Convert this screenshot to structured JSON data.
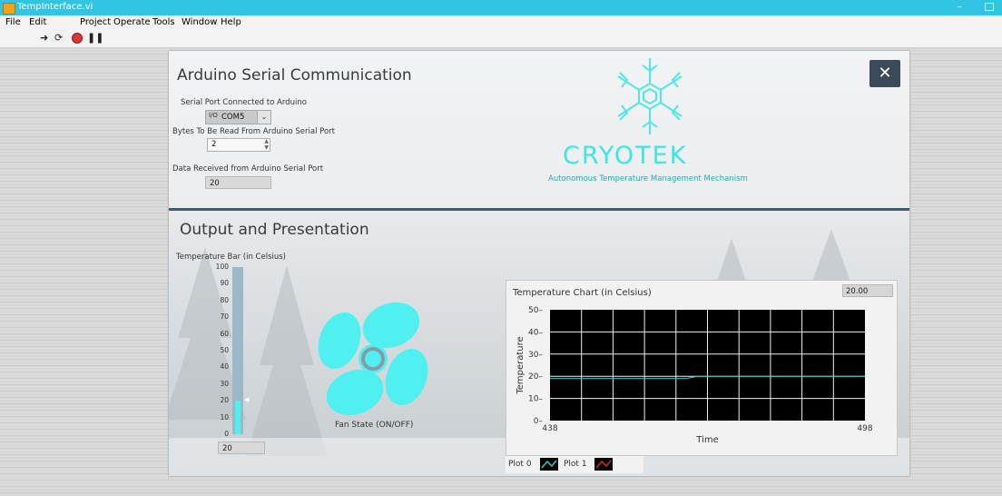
{
  "window": {
    "title": "TempInterface.vi"
  },
  "menu": [
    "File",
    "Edit",
    "Project",
    "Operate",
    "Tools",
    "Window",
    "Help"
  ],
  "serial": {
    "heading": "Arduino Serial Communication",
    "port_label": "Serial Port Connected to Arduino",
    "port_value": "COM5",
    "bytes_label": "Bytes To Be Read From Arduino Serial Port",
    "bytes_value": "2",
    "received_label": "Data Received from Arduino Serial Port",
    "received_value": "20"
  },
  "brand": {
    "name": "CRYOTEK",
    "tagline": "Autonomous Temperature Management Mechanism",
    "close_label": "✕"
  },
  "output": {
    "heading": "Output and Presentation",
    "bar_label": "Temperature Bar (in Celsius)",
    "bar_value": "20",
    "bar_level": 20,
    "bar_ticks": [
      "100",
      "90",
      "80",
      "70",
      "60",
      "50",
      "40",
      "30",
      "20",
      "10",
      "0"
    ],
    "fan_label": "Fan State (ON/OFF)"
  },
  "chart_data": {
    "type": "line",
    "title": "Temperature Chart (in Celsius)",
    "current_value": "20.00",
    "xlabel": "Time",
    "ylabel": "Temperature",
    "xlim": [
      438,
      498
    ],
    "ylim": [
      0,
      50
    ],
    "x_ticks": [
      "438",
      "498"
    ],
    "y_ticks": [
      "0",
      "10",
      "20",
      "30",
      "40",
      "50"
    ],
    "grid": true,
    "series": [
      {
        "name": "Plot 0",
        "color": "#39c6c6",
        "x": [
          438,
          445,
          450,
          455,
          460,
          464,
          466,
          470,
          475,
          480,
          484,
          486,
          490,
          498
        ],
        "y": [
          19,
          19,
          19,
          19,
          19,
          19,
          20,
          20,
          20,
          20,
          20,
          20,
          20,
          20
        ]
      }
    ],
    "legend": [
      {
        "name": "Plot 0",
        "color": "#39c6c6"
      },
      {
        "name": "Plot 1",
        "color": "#d22a2a"
      }
    ]
  },
  "colors": {
    "accent": "#3ee6e0",
    "titlebar": "#33c3e3",
    "divider": "#3e5a74"
  }
}
